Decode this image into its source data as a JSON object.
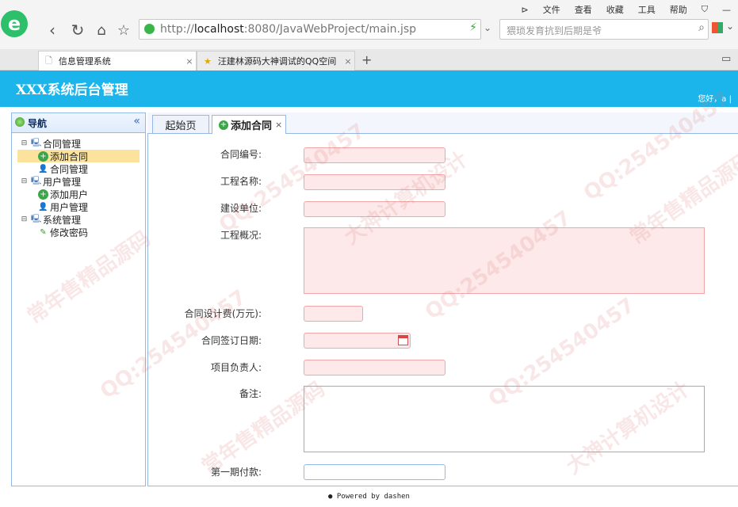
{
  "browser": {
    "menu": [
      "文件",
      "查看",
      "收藏",
      "工具",
      "帮助"
    ],
    "address_scheme": "http://",
    "address_host": "localhost",
    "address_rest": ":8080/JavaWebProject/main.jsp",
    "search_placeholder": "猥琐发育抗到后期是爷",
    "tabs": [
      {
        "label": "信息管理系统"
      },
      {
        "label": "汪建林源码大神调试的QQ空间"
      }
    ]
  },
  "app": {
    "title": "XXX系统后台管理",
    "greeting": "您好，a | "
  },
  "sidebar": {
    "title": "导航",
    "collapse": "«",
    "tree": [
      {
        "label": "合同管理",
        "children": [
          {
            "label": "添加合同",
            "selected": true
          },
          {
            "label": "合同管理"
          }
        ]
      },
      {
        "label": "用户管理",
        "children": [
          {
            "label": "添加用户"
          },
          {
            "label": "用户管理"
          }
        ]
      },
      {
        "label": "系统管理",
        "children": [
          {
            "label": "修改密码"
          }
        ]
      }
    ]
  },
  "tabs": {
    "home": "起始页",
    "active": "添加合同",
    "close": "×"
  },
  "form": {
    "contract_no": "合同编号:",
    "project_name": "工程名称:",
    "builder": "建设单位:",
    "overview": "工程概况:",
    "design_fee": "合同设计费(万元):",
    "sign_date": "合同签订日期:",
    "manager": "项目负责人:",
    "remark": "备注:",
    "first_payment": "第一期付款:"
  },
  "footer": "Powered by dashen",
  "watermarks": [
    "常年售精品源码",
    "QQ:254540457",
    "大神计算机设计"
  ],
  "colors": {
    "header": "#1bb5ec",
    "border": "#95b8e7",
    "invalid_bg": "#fde9e9",
    "invalid_border": "#f1a7a7",
    "selected": "#fbe29d"
  }
}
